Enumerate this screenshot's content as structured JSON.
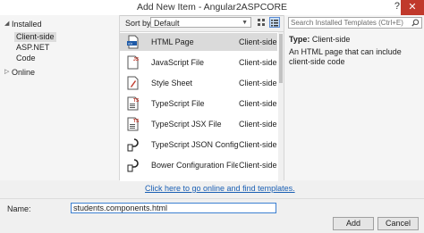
{
  "window": {
    "title": "Add New Item - Angular2ASPCORE",
    "help_label": "?",
    "close_label": "✕"
  },
  "sidebar": {
    "installed_label": "Installed",
    "children": [
      {
        "label": "Client-side"
      },
      {
        "label": "ASP.NET"
      },
      {
        "label": "Code"
      }
    ],
    "online_label": "Online"
  },
  "toolbar": {
    "sort_label": "Sort by:",
    "sort_value": "Default"
  },
  "templates": [
    {
      "name": "HTML Page",
      "category": "Client-side",
      "icon": "html-page-icon"
    },
    {
      "name": "JavaScript File",
      "category": "Client-side",
      "icon": "javascript-file-icon"
    },
    {
      "name": "Style Sheet",
      "category": "Client-side",
      "icon": "style-sheet-icon"
    },
    {
      "name": "TypeScript File",
      "category": "Client-side",
      "icon": "typescript-file-icon"
    },
    {
      "name": "TypeScript JSX File",
      "category": "Client-side",
      "icon": "typescript-jsx-file-icon"
    },
    {
      "name": "TypeScript JSON Configurati...",
      "category": "Client-side",
      "icon": "json-config-icon"
    },
    {
      "name": "Bower Configuration File",
      "category": "Client-side",
      "icon": "bower-config-icon"
    }
  ],
  "online_link": "Click here to go online and find templates.",
  "search": {
    "placeholder": "Search Installed Templates (Ctrl+E)"
  },
  "details": {
    "type_label": "Type:",
    "type_value": "Client-side",
    "description": "An HTML page that can include client-side code"
  },
  "name_field": {
    "label": "Name:",
    "value": "students.components.html"
  },
  "buttons": {
    "add": "Add",
    "cancel": "Cancel"
  }
}
